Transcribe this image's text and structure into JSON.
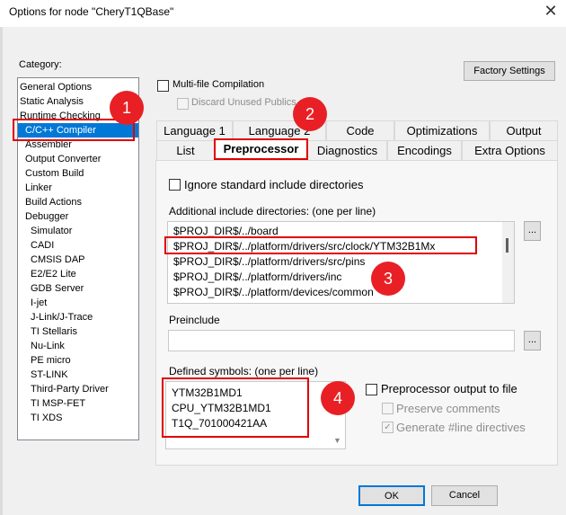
{
  "window": {
    "title": "Options for node \"CheryT1QBase\"",
    "close_glyph": "✕"
  },
  "category": {
    "label": "Category:",
    "items": [
      "General Options",
      "Static Analysis",
      "Runtime Checking",
      "C/C++ Compiler",
      "Assembler",
      "Output Converter",
      "Custom Build",
      "Linker",
      "Build Actions",
      "Debugger",
      "Simulator",
      "CADI",
      "CMSIS DAP",
      "E2/E2 Lite",
      "GDB Server",
      "I-jet",
      "J-Link/J-Trace",
      "TI Stellaris",
      "Nu-Link",
      "PE micro",
      "ST-LINK",
      "Third-Party Driver",
      "TI MSP-FET",
      "TI XDS"
    ],
    "selected": "C/C++ Compiler"
  },
  "factory_settings": "Factory Settings",
  "multifile": {
    "label": "Multi-file Compilation",
    "checked": false
  },
  "discard_unused": {
    "label": "Discard Unused Publics",
    "checked": false,
    "disabled": true
  },
  "tabs_row1": [
    "Language 1",
    "Language 2",
    "Code",
    "Optimizations",
    "Output"
  ],
  "tabs_row2": [
    "List",
    "Preprocessor",
    "Diagnostics",
    "Encodings",
    "Extra Options"
  ],
  "active_tab": "Preprocessor",
  "ignore_std": {
    "label": "Ignore standard include directories",
    "checked": false
  },
  "include_dirs": {
    "label": "Additional include directories: (one per line)",
    "lines": [
      "$PROJ_DIR$/../board",
      "$PROJ_DIR$/../platform/drivers/src/clock/YTM32B1Mx",
      "$PROJ_DIR$/../platform/drivers/src/pins",
      "$PROJ_DIR$/../platform/drivers/inc",
      "$PROJ_DIR$/../platform/devices/common"
    ],
    "browse": "..."
  },
  "preinclude": {
    "label": "Preinclude",
    "value": "",
    "browse": "..."
  },
  "defined_symbols": {
    "label": "Defined symbols: (one per line)",
    "lines": [
      "YTM32B1MD1",
      "CPU_YTM32B1MD1",
      "T1Q_701000421AA"
    ]
  },
  "pp_output": {
    "label": "Preprocessor output to file",
    "checked": false
  },
  "preserve_comments": {
    "label": "Preserve comments",
    "checked": false,
    "disabled": true
  },
  "generate_line": {
    "label": "Generate #line directives",
    "checked": true,
    "disabled": true
  },
  "ok": "OK",
  "cancel": "Cancel",
  "annotations": [
    "1",
    "2",
    "3",
    "4"
  ],
  "colors": {
    "accent": "#0078d7",
    "annotation_red": "#e82025"
  }
}
